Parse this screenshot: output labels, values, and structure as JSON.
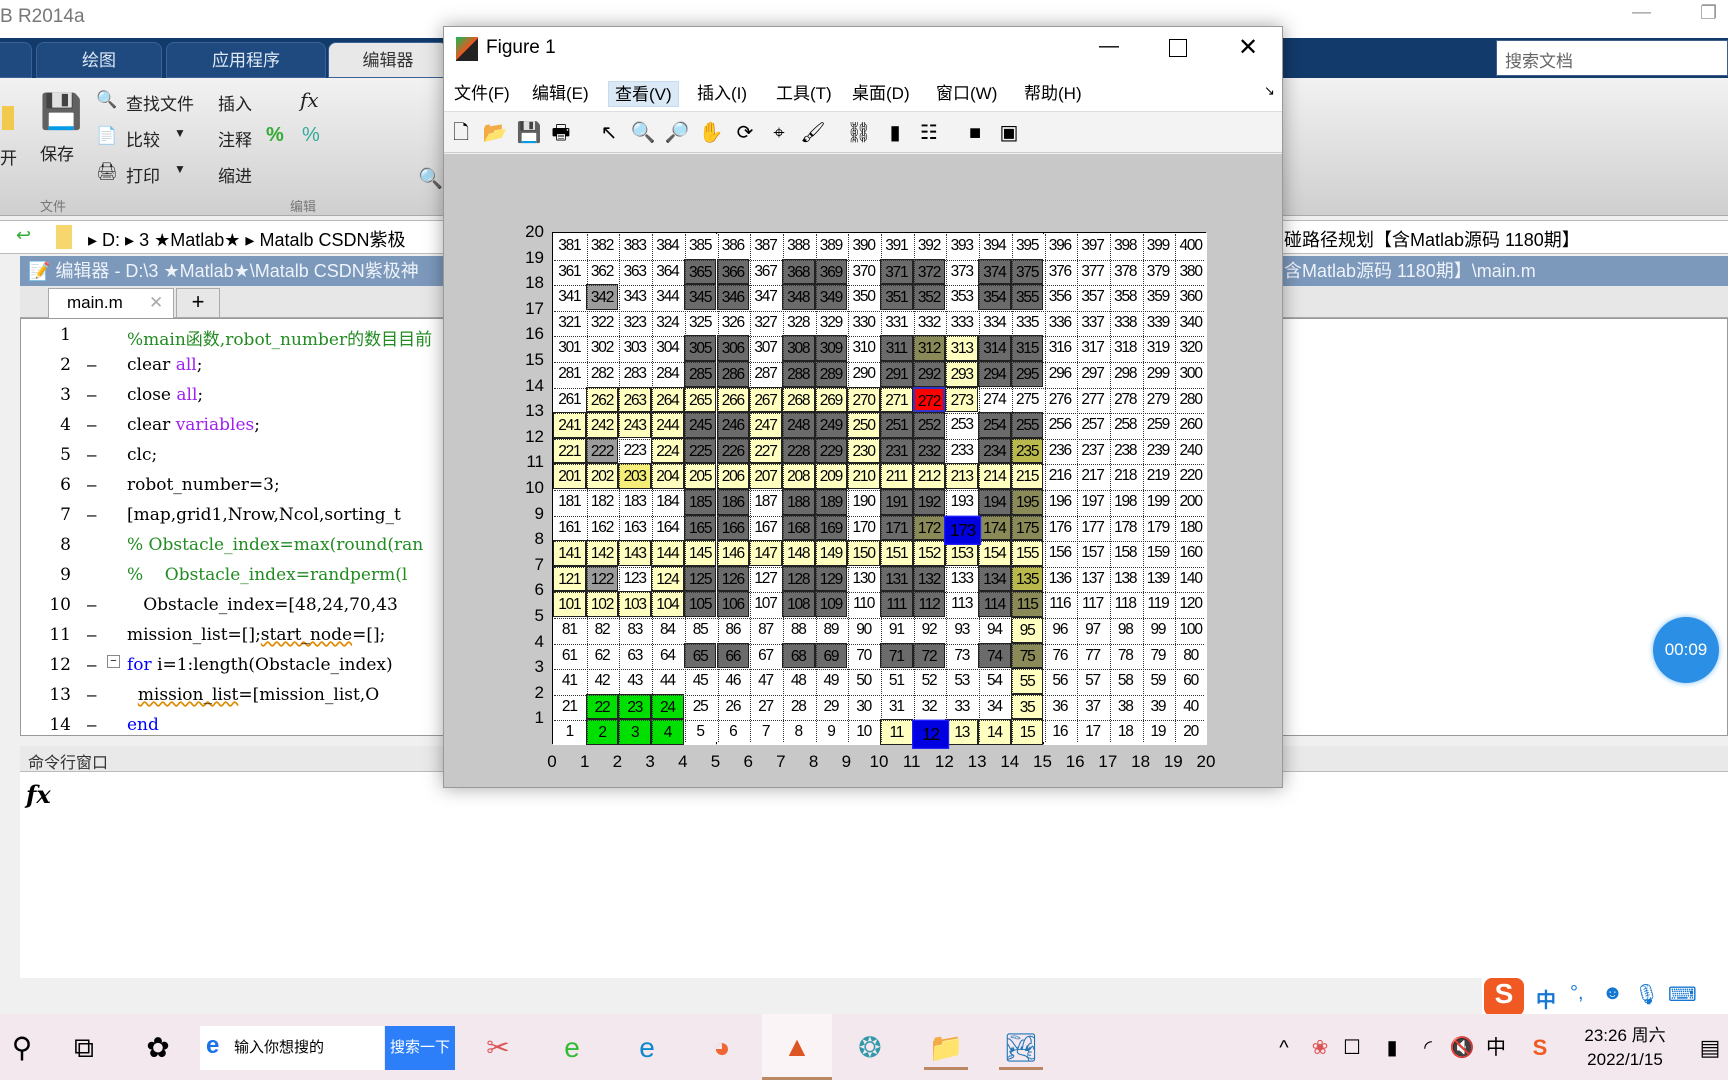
{
  "app": {
    "title": "B R2014a"
  },
  "ribbon": {
    "tabs": [
      "绘图",
      "应用程序",
      "编辑器"
    ],
    "file_items": [
      "查找文件",
      "比较",
      "打印"
    ],
    "open": "开",
    "save": "保存",
    "edit_items": [
      "插入",
      "注释",
      "缩进"
    ],
    "group_file": "文件",
    "group_edit": "编辑",
    "search_placeholder": "搜索文档"
  },
  "address": {
    "parts": [
      "D:",
      "3 ★Matlab★",
      "Matalb CSDN紫极"
    ],
    "tail": "碰路径规划【含Matlab源码 1180期】"
  },
  "editor": {
    "title": "编辑器 - D:\\3 ★Matlab★\\Matalb CSDN紫极神",
    "title_tail": "含Matlab源码 1180期】\\main.m",
    "tab": "main.m",
    "add_tab": "+",
    "lines": [
      {
        "n": "1",
        "d": "",
        "seg": [
          [
            "%main函数,robot_number的数目目前",
            "cm"
          ]
        ]
      },
      {
        "n": "2",
        "d": "–",
        "seg": [
          [
            "clear ",
            ""
          ],
          [
            "all",
            "st"
          ],
          [
            ";",
            ""
          ]
        ]
      },
      {
        "n": "3",
        "d": "–",
        "seg": [
          [
            "close ",
            ""
          ],
          [
            "all",
            "st"
          ],
          [
            ";",
            ""
          ]
        ]
      },
      {
        "n": "4",
        "d": "–",
        "seg": [
          [
            "clear ",
            ""
          ],
          [
            "variables",
            "st"
          ],
          [
            ";",
            ""
          ]
        ]
      },
      {
        "n": "5",
        "d": "–",
        "seg": [
          [
            "clc;",
            ""
          ]
        ]
      },
      {
        "n": "6",
        "d": "–",
        "seg": [
          [
            "robot_number=3;",
            ""
          ]
        ]
      },
      {
        "n": "7",
        "d": "–",
        "seg": [
          [
            "[map,grid1,Nrow,Ncol,sorting_t",
            ""
          ]
        ]
      },
      {
        "n": "8",
        "d": "",
        "seg": [
          [
            "% Obstacle_index=max(round(ran",
            "cm"
          ]
        ]
      },
      {
        "n": "9",
        "d": "",
        "seg": [
          [
            "%    Obstacle_index=randperm(l",
            "cm"
          ]
        ]
      },
      {
        "n": "10",
        "d": "–",
        "seg": [
          [
            "   Obstacle_index=[48,24,70,43",
            ""
          ]
        ]
      },
      {
        "n": "11",
        "d": "–",
        "seg": [
          [
            "mission_list=[];",
            ""
          ],
          [
            "start_node",
            "sq"
          ],
          [
            "=[];",
            ""
          ]
        ]
      },
      {
        "n": "12",
        "d": "–",
        "seg": [
          [
            "for ",
            "kw"
          ],
          [
            "i=1:length(Obstacle_index)",
            ""
          ]
        ]
      },
      {
        "n": "13",
        "d": "–",
        "seg": [
          [
            "  ",
            ""
          ],
          [
            "mission_list",
            "sq"
          ],
          [
            "=[mission_list,O",
            ""
          ]
        ]
      },
      {
        "n": "14",
        "d": "–",
        "seg": [
          [
            "end",
            "kw"
          ]
        ]
      }
    ]
  },
  "command": {
    "title": "命令行窗口",
    "prompt": "fx"
  },
  "figure": {
    "title": "Figure 1",
    "menu": [
      "文件(F)",
      "编辑(E)",
      "查看(V)",
      "插入(I)",
      "工具(T)",
      "桌面(D)",
      "窗口(W)",
      "帮助(H)"
    ],
    "toolbar": [
      "new-file",
      "open",
      "save",
      "print",
      "pointer",
      "zoom-in",
      "zoom-out",
      "pan",
      "rotate-3d",
      "data-cursor",
      "brush",
      "link",
      "colorbar",
      "legend",
      "hide-plot-tools",
      "show-plot-tools"
    ]
  },
  "chart_data": {
    "type": "heatmap",
    "xlim": [
      0,
      20
    ],
    "ylim": [
      0,
      20
    ],
    "xticks": [
      "0",
      "1",
      "2",
      "3",
      "4",
      "5",
      "6",
      "7",
      "8",
      "9",
      "10",
      "11",
      "12",
      "13",
      "14",
      "15",
      "16",
      "17",
      "18",
      "19",
      "20"
    ],
    "yticks": [
      "1",
      "2",
      "3",
      "4",
      "5",
      "6",
      "7",
      "8",
      "9",
      "10",
      "11",
      "12",
      "13",
      "14",
      "15",
      "16",
      "17",
      "18",
      "19",
      "20"
    ],
    "grid": "dotted",
    "cell_labels": "row*20+col+1 (1-400)",
    "colors": {
      "w": "#ffffff",
      "g": "#6b6b6b",
      "l": "#9c9c9c",
      "y": "#ffffc0",
      "Y": "#f4ee78",
      "o": "#8a8a58",
      "k": "#b8b84c",
      "G": "#00e000",
      "B": "#0000e0",
      "R": "#ff0000"
    },
    "rows_top_to_bottom": [
      "wwwwwwwwwwwwwwwwwwww",
      "wwwwggwggwggwggwwwww",
      "wlwwggwggwggwggwwwww",
      "wwwwwwwwwwwwwwwwwwww",
      "wwwwggwggwgoyggwwwww",
      "wwwwggwggwggyggwwwww",
      "wyyyyyyyyyyRywwwwwww",
      "yyyyggyggyggwggwwwww",
      "ylwyggyggyggwgkwwwww",
      "yyYyyyyyyyyyyyywwwww",
      "wwwwggwggwggwgowwwww",
      "wwwwggwggwgoBoowwwww",
      "yyyyyyyyyyyyyyywwwww",
      "ylwyggwggwggwgkwwwww",
      "yyyyggwggwggwgowwwww",
      "wwwwwwwwwwwwwwywwwww",
      "wwwwggwggwggwgowwwww",
      "wwwwwwwwwwwwwwywwwww",
      "wGGGwwwwwwwwwwywwwww",
      "wGGGwwwwwwyByyywwwww"
    ]
  },
  "timer": "00:09",
  "taskbar": {
    "search_placeholder": "输入你想搜的",
    "search_button": "搜索一下",
    "time": "23:26 周六",
    "date": "2022/1/15"
  },
  "ime": {
    "lang": "中"
  }
}
